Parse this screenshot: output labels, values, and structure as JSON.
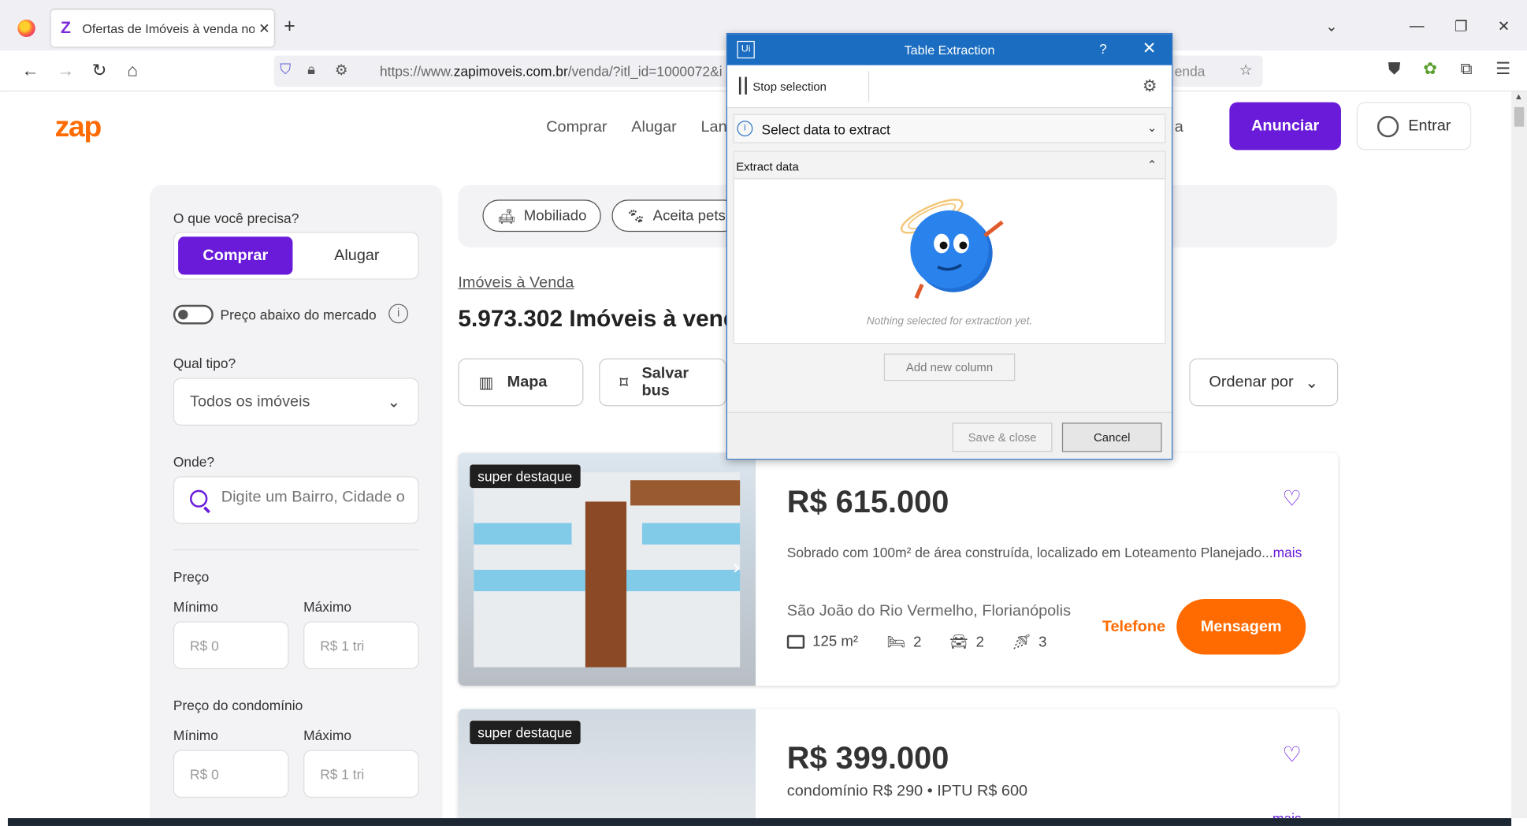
{
  "browser": {
    "tab_title": "Ofertas de Imóveis à venda no",
    "tab_close": "✕",
    "new_tab": "+",
    "url_prefix": "https://www.",
    "url_domain": "zapimoveis.com.br",
    "url_path": "/venda/?itl_id=1000072&i",
    "url_tail": "enda"
  },
  "site": {
    "logo": "zap",
    "nav": [
      "Comprar",
      "Alugar",
      "Lan",
      "a"
    ],
    "anunciar": "Anunciar",
    "entrar": "Entrar"
  },
  "sidebar": {
    "need_label": "O que você precisa?",
    "buy": "Comprar",
    "rent": "Alugar",
    "below_market": "Preço abaixo do mercado",
    "type_label": "Qual tipo?",
    "type_value": "Todos os imóveis",
    "where_label": "Onde?",
    "where_placeholder": "Digite um Bairro, Cidade o",
    "price_label": "Preço",
    "min_label": "Mínimo",
    "max_label": "Máximo",
    "min_placeholder": "R$ 0",
    "max_placeholder": "R$ 1 tri",
    "condo_label": "Preço do condomínio",
    "condo_min_label": "Mínimo",
    "condo_max_label": "Máximo",
    "condo_min_placeholder": "R$ 0",
    "condo_max_placeholder": "R$ 1 tri"
  },
  "filters": {
    "chips": [
      "Mobiliado",
      "Aceita pets"
    ],
    "breadcrumb": "Imóveis à Venda",
    "result_count": "5.973.302 Imóveis à vend",
    "map": "Mapa",
    "save_search": "Salvar bus",
    "order": "Ordenar por"
  },
  "listings": [
    {
      "badge": "super destaque",
      "price": "R$ 615.000",
      "desc": "Sobrado com 100m² de área construída, localizado em Loteamento Planejado...",
      "more": "mais",
      "location": "São João do Rio Vermelho, Florianópolis",
      "area": "125 m²",
      "bedrooms": "2",
      "parking": "2",
      "bathrooms": "3",
      "phone": "Telefone",
      "message": "Mensagem"
    },
    {
      "badge": "super destaque",
      "price": "R$ 399.000",
      "condo": "condomínio R$ 290  •  IPTU R$ 600",
      "more": "mais"
    }
  ],
  "dialog": {
    "icon": "Ui",
    "title": "Table Extraction",
    "help": "?",
    "close": "✕",
    "stop_selection": "Stop selection",
    "select_data": "Select data to extract",
    "extract_data": "Extract data",
    "empty_message": "Nothing selected for extraction yet.",
    "add_column": "Add new column",
    "save_close": "Save & close",
    "cancel": "Cancel"
  },
  "colors": {
    "brand_purple": "#6a1bd9",
    "brand_orange": "#ff6b00",
    "dialog_blue": "#1b6dc1"
  }
}
